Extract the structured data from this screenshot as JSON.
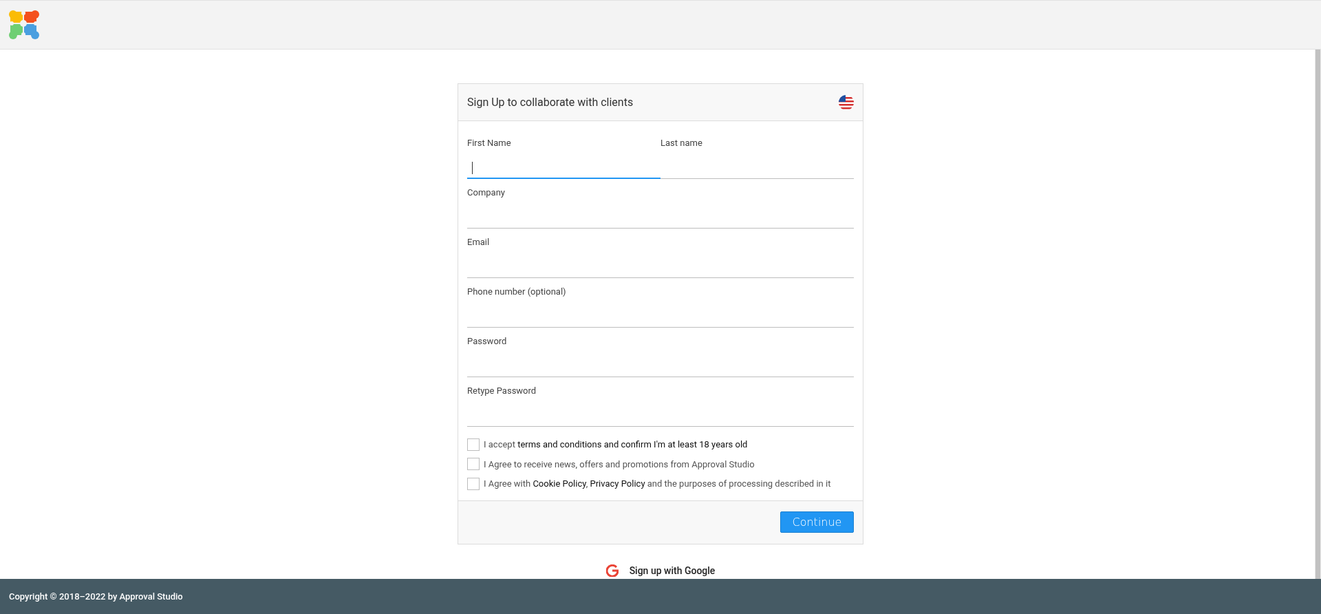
{
  "card": {
    "title": "Sign Up to collaborate with clients",
    "field_rows": [
      [
        {
          "label": "First Name",
          "focused": true
        },
        {
          "label": "Last name",
          "focused": false
        }
      ],
      [
        {
          "label": "Company",
          "focused": false
        }
      ],
      [
        {
          "label": "Email",
          "focused": false
        }
      ],
      [
        {
          "label": "Phone number (optional)",
          "focused": false
        }
      ],
      [
        {
          "label": "Password",
          "focused": false
        }
      ],
      [
        {
          "label": "Retype Password",
          "focused": false
        }
      ]
    ],
    "checkboxes": [
      {
        "checked": false,
        "parts": [
          {
            "kind": "text",
            "text": "I accept "
          },
          {
            "kind": "link",
            "text": "terms and conditions and confirm I'm at least 18 years old"
          }
        ]
      },
      {
        "checked": false,
        "parts": [
          {
            "kind": "text",
            "text": "I Agree to receive news, offers and promotions from Approval Studio"
          }
        ]
      },
      {
        "checked": false,
        "parts": [
          {
            "kind": "text",
            "text": "I Agree with "
          },
          {
            "kind": "link",
            "text": "Cookie Policy"
          },
          {
            "kind": "text",
            "text": ", "
          },
          {
            "kind": "link",
            "text": "Privacy Policy"
          },
          {
            "kind": "text",
            "text": " and the purposes of processing described in it"
          }
        ]
      }
    ],
    "button": "Continue"
  },
  "google_signup": "Sign up with Google",
  "footer": "Copyright © 2018–2022 by Approval Studio"
}
